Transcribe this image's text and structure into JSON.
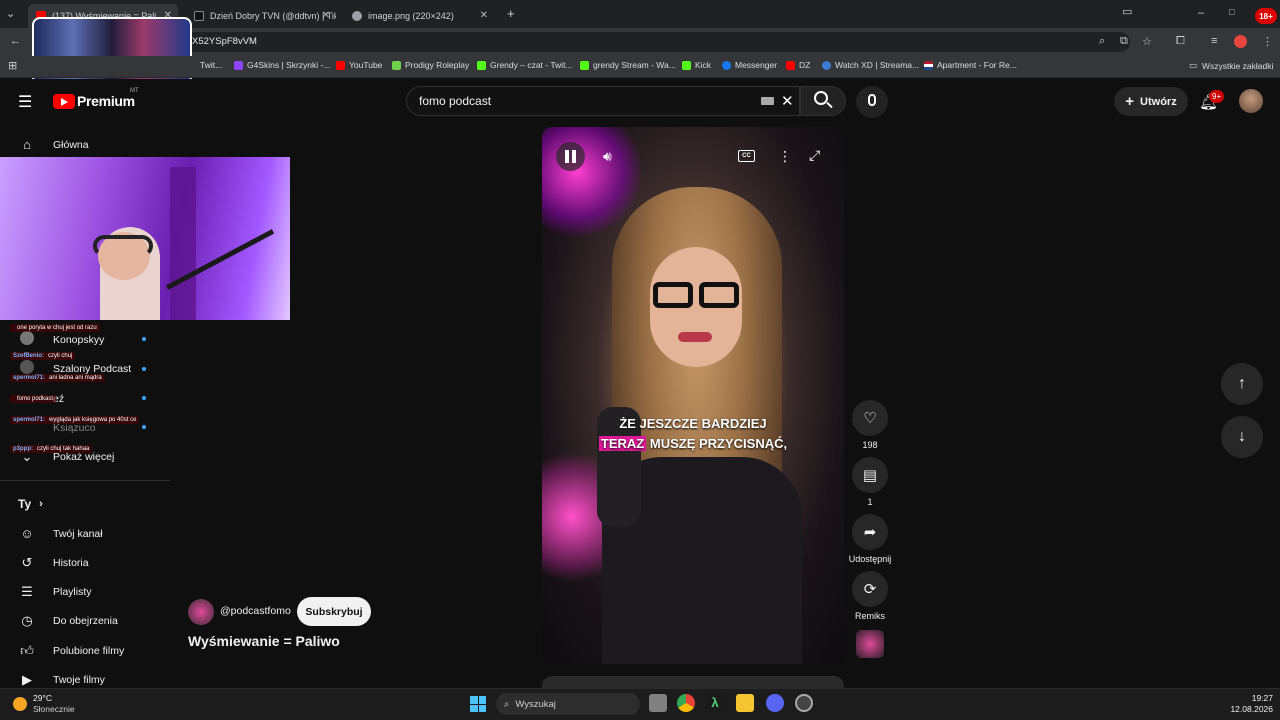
{
  "browser": {
    "tabs": [
      {
        "title": "(137) Wyśmiewanie = Pali",
        "active": true
      },
      {
        "title": "Dzień Dobry TVN (@ddtvn) | Tik"
      },
      {
        "title": "image.png (220×242)"
      }
    ],
    "new_tab": "+",
    "url_fragment": "X52YSpF8vVM",
    "bookmarks": [
      "Twit...",
      "G4Skins | Skrzynki -...",
      "YouTube",
      "Prodigy Roleplay",
      "Grendy – czat - Twit...",
      "grendy Stream - Wa...",
      "Kick",
      "Messenger",
      "DZ",
      "Watch XD | Streama...",
      "Apartment - For Re..."
    ],
    "all_bookmarks": "Wszystkie zakładki",
    "window_controls": [
      "–",
      "□",
      "✕"
    ],
    "badge_18": "18+"
  },
  "youtube": {
    "logo_text": "Premium",
    "logo_sup": "MT",
    "search_value": "fomo podcast",
    "create_label": "Utwórz",
    "notif_count": "9+",
    "sidebar_top": [
      {
        "label": "Główna",
        "icon": "home-icon"
      }
    ],
    "subscriptions": [
      "Konopskyy",
      "Szalony Podcast",
      "eź",
      "Ksiązuco",
      "Pokaż więcej"
    ],
    "you_header": "Ty",
    "you_items": [
      {
        "label": "Twój kanał",
        "icon": "channel-icon"
      },
      {
        "label": "Historia",
        "icon": "history-icon"
      },
      {
        "label": "Playlisty",
        "icon": "playlist-icon"
      },
      {
        "label": "Do obejrzenia",
        "icon": "clock-icon"
      },
      {
        "label": "Polubione filmy",
        "icon": "thumb-up-icon"
      },
      {
        "label": "Twoje filmy",
        "icon": "video-icon"
      }
    ],
    "chat": [
      {
        "user": "",
        "text": "one poryta w chuj jest od razu"
      },
      {
        "user": "SzefBenio:",
        "text": "czyli chuj"
      },
      {
        "user": "spermol71:",
        "text": "ani ładna ani mądra"
      },
      {
        "user": "",
        "text": "fomo podkast"
      },
      {
        "user": "spermol71:",
        "text": "wygląda jak księgowa po 40st ce"
      },
      {
        "user": "p3ppp:",
        "text": "czyli chuj tak hahaa"
      }
    ],
    "channel_handle": "@podcastfomo",
    "subscribe_label": "Subskrybuj",
    "video_title": "Wyśmiewanie = Paliwo",
    "caption_line1": "ŻE JESZCZE BARDZIEJ",
    "caption_line2_hl": "TERAZ",
    "caption_line2_rest": " MUSZĘ PRZYCISNĄĆ,",
    "likes": "198",
    "comments": "1",
    "share_label": "Udostępnij",
    "remix_label": "Remiks"
  },
  "taskbar": {
    "weather_temp": "29°C",
    "weather_desc": "Słonecznie",
    "search_placeholder": "Wyszukaj",
    "time": "19:27",
    "date": "12.08.2026"
  },
  "colors": {
    "yt_red": "#ff0000",
    "bg": "#0f0f0f",
    "caption_highlight": "#e0189a"
  }
}
